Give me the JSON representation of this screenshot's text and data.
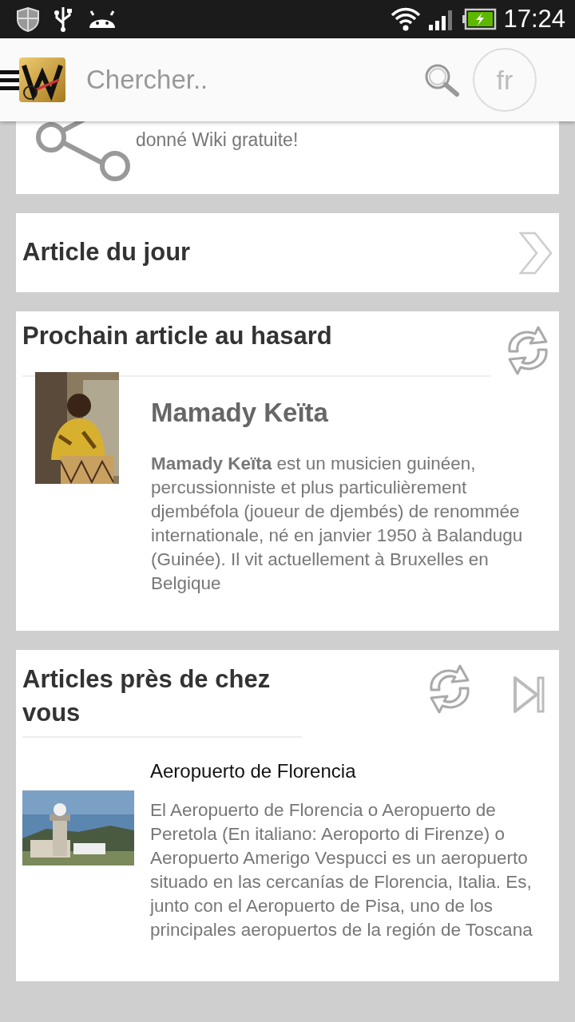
{
  "status_bar": {
    "time": "17:24"
  },
  "header": {
    "search": {
      "placeholder": "Chercher.."
    },
    "language": "fr"
  },
  "share_card": {
    "text": "donné Wiki gratuite!"
  },
  "article_of_day": {
    "title": "Article du jour"
  },
  "random_article": {
    "heading": "Prochain article au hasard",
    "title": "Mamady Keïta",
    "summary": "**Mamady Keïta** est un musicien guinéen, percussionniste et plus particulièrement djembéfola (joueur de djembés) de renommée internationale, né en janvier 1950 à Balandugu (Guinée). Il vit actuellement à Bruxelles en Belgique"
  },
  "nearby": {
    "heading": "Articles près de chez vous",
    "items": [
      {
        "title": "Aeropuerto de Florencia",
        "summary": "El Aeropuerto de Florencia o Aeropuerto de Peretola (En  italiano: Aeroporto di Firenze) o Aeropuerto Amerigo Vespucci es un aeropuerto situado en las cercanías de Florencia,  Italia. Es, junto con el Aeropuerto de Pisa, uno de los principales aeropuertos de la región de  Toscana"
      }
    ]
  }
}
